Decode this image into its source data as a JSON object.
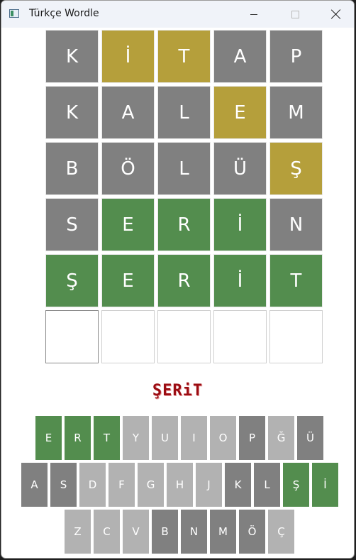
{
  "window": {
    "title": "Türkçe Wordle"
  },
  "board": {
    "rows": [
      [
        {
          "letter": "K",
          "state": "absent"
        },
        {
          "letter": "İ",
          "state": "present"
        },
        {
          "letter": "T",
          "state": "present"
        },
        {
          "letter": "A",
          "state": "absent"
        },
        {
          "letter": "P",
          "state": "absent"
        }
      ],
      [
        {
          "letter": "K",
          "state": "absent"
        },
        {
          "letter": "A",
          "state": "absent"
        },
        {
          "letter": "L",
          "state": "absent"
        },
        {
          "letter": "E",
          "state": "present"
        },
        {
          "letter": "M",
          "state": "absent"
        }
      ],
      [
        {
          "letter": "B",
          "state": "absent"
        },
        {
          "letter": "Ö",
          "state": "absent"
        },
        {
          "letter": "L",
          "state": "absent"
        },
        {
          "letter": "Ü",
          "state": "absent"
        },
        {
          "letter": "Ş",
          "state": "present"
        }
      ],
      [
        {
          "letter": "S",
          "state": "absent"
        },
        {
          "letter": "E",
          "state": "correct"
        },
        {
          "letter": "R",
          "state": "correct"
        },
        {
          "letter": "İ",
          "state": "correct"
        },
        {
          "letter": "N",
          "state": "absent"
        }
      ],
      [
        {
          "letter": "Ş",
          "state": "correct"
        },
        {
          "letter": "E",
          "state": "correct"
        },
        {
          "letter": "R",
          "state": "correct"
        },
        {
          "letter": "İ",
          "state": "correct"
        },
        {
          "letter": "T",
          "state": "correct"
        }
      ],
      [
        {
          "letter": "",
          "state": "empty"
        },
        {
          "letter": "",
          "state": "empty"
        },
        {
          "letter": "",
          "state": "empty"
        },
        {
          "letter": "",
          "state": "empty"
        },
        {
          "letter": "",
          "state": "empty"
        }
      ]
    ]
  },
  "answer_text": "ŞERiT",
  "keyboard": {
    "rows": [
      [
        {
          "label": "E",
          "state": "correct"
        },
        {
          "label": "R",
          "state": "correct"
        },
        {
          "label": "T",
          "state": "correct"
        },
        {
          "label": "Y",
          "state": "unused"
        },
        {
          "label": "U",
          "state": "unused"
        },
        {
          "label": "I",
          "state": "unused"
        },
        {
          "label": "O",
          "state": "unused"
        },
        {
          "label": "P",
          "state": "absent"
        },
        {
          "label": "Ğ",
          "state": "unused"
        },
        {
          "label": "Ü",
          "state": "absent"
        }
      ],
      [
        {
          "label": "A",
          "state": "absent"
        },
        {
          "label": "S",
          "state": "absent"
        },
        {
          "label": "D",
          "state": "unused"
        },
        {
          "label": "F",
          "state": "unused"
        },
        {
          "label": "G",
          "state": "unused"
        },
        {
          "label": "H",
          "state": "unused"
        },
        {
          "label": "J",
          "state": "unused"
        },
        {
          "label": "K",
          "state": "absent"
        },
        {
          "label": "L",
          "state": "absent"
        },
        {
          "label": "Ş",
          "state": "correct"
        },
        {
          "label": "İ",
          "state": "correct"
        }
      ],
      [
        {
          "label": "Z",
          "state": "unused"
        },
        {
          "label": "C",
          "state": "unused"
        },
        {
          "label": "V",
          "state": "unused"
        },
        {
          "label": "B",
          "state": "absent"
        },
        {
          "label": "N",
          "state": "absent"
        },
        {
          "label": "M",
          "state": "absent"
        },
        {
          "label": "Ö",
          "state": "absent"
        },
        {
          "label": "Ç",
          "state": "unused"
        }
      ]
    ]
  },
  "colors": {
    "correct": "#538d4e",
    "present": "#b59f3b",
    "absent": "#808080",
    "unused_key": "#b2b2b2",
    "answer_text": "#9b0c12"
  },
  "icons": {
    "app": "wordle-app-icon",
    "minimize": "minimize-icon",
    "maximize": "maximize-icon",
    "close": "close-icon"
  }
}
